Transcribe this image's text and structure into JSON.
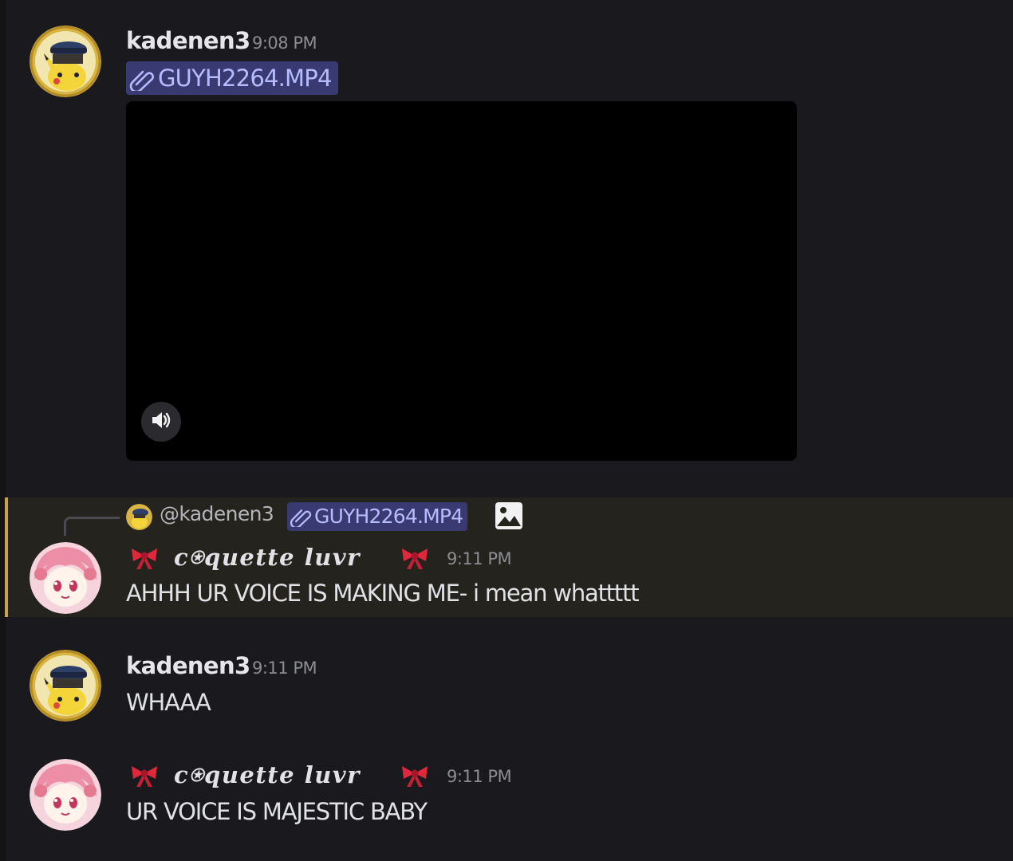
{
  "messages": [
    {
      "username": "kadenen3",
      "time": "9:08 PM",
      "attachment": {
        "filename": "GUYH2264.MP4"
      }
    },
    {
      "reply_to": {
        "mention": "@kadenen3",
        "attachment": "GUYH2264.MP4"
      },
      "username": "c⍟quette luvr",
      "time": "9:11 PM",
      "text": "AHHH UR VOICE IS MAKING ME- i mean whattttt"
    },
    {
      "username": "kadenen3",
      "time": "9:11 PM",
      "text": "WHAAA"
    },
    {
      "username": "c⍟quette luvr",
      "time": "9:11 PM",
      "text": "UR VOICE IS MAJESTIC BABY"
    }
  ],
  "icons": {
    "attachment": "paperclip-icon",
    "volume": "volume-icon",
    "image": "image-icon",
    "bow": "bow-emoji"
  },
  "colors": {
    "background": "#1a1a1e",
    "highlight": "#25231e",
    "highlight_bar": "#c8a24e",
    "chip_bg": "#3a3a72",
    "chip_text": "#b7bcff",
    "bow": "#e0283c"
  }
}
